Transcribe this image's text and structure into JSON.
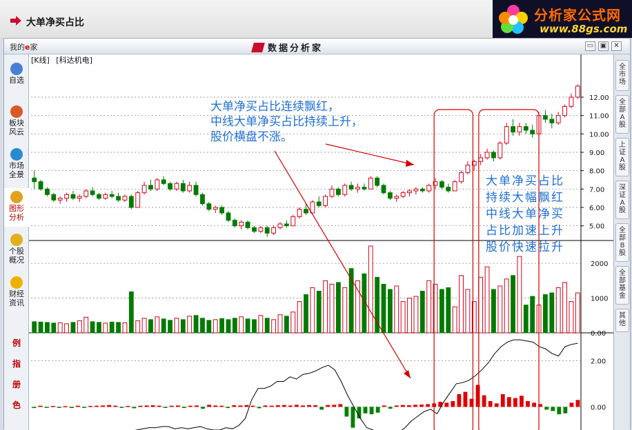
{
  "topbar": {
    "title": "大单净买占比"
  },
  "logo": {
    "line1": "分析家公式网",
    "line2": "www.88gs.com"
  },
  "window": {
    "home_label": "我的",
    "home_suffix": "家",
    "title": "数据分析家",
    "btn_min": "▭",
    "btn_max": "▣",
    "btn_close": "✕"
  },
  "left_sidebar": [
    {
      "label": "自选",
      "icon": "magnifier-icon",
      "color": "#4a7fd6"
    },
    {
      "label": "板块\n风云",
      "icon": "blocks-icon",
      "color": "#d85a28"
    },
    {
      "label": "市场\n全景",
      "icon": "globe-icon",
      "color": "#2a8ad0"
    },
    {
      "label": "图形\n分析",
      "icon": "chart-icon",
      "color": "#e0a020"
    },
    {
      "label": "个股\n概况",
      "icon": "stock-icon",
      "color": "#e0b020"
    },
    {
      "label": "财经\n资讯",
      "icon": "finance-icon",
      "color": "#f0b000"
    }
  ],
  "left_tools": [
    "例",
    "指",
    "册",
    "色"
  ],
  "right_tabs": [
    "全市场",
    "全部A股",
    "上证A股",
    "深证A股",
    "全部B股",
    "全部基金",
    "其他"
  ],
  "chart_header": {
    "period": "[K线]",
    "stock": "[科达机电]"
  },
  "annotations": {
    "left": [
      "大单净买占比连续飘红，",
      "中线大单净买占比持续上升，",
      "股价横盘不涨。"
    ],
    "right": [
      "大单净买占比",
      "持续大幅飘红",
      "中线大单净买",
      "占比加速上升",
      "股价快速拉升"
    ]
  },
  "chart_data": [
    {
      "type": "candlestick",
      "ylim": [
        4.2,
        13.2
      ],
      "y_ticks": [
        "12.00",
        "11.00",
        "10.00",
        "9.00",
        "8.00",
        "7.00",
        "6.00",
        "5.00"
      ],
      "up_color": "#d0021b",
      "down_color": "#007a00",
      "candles": [
        [
          7.6,
          8.0,
          7.0,
          7.4
        ],
        [
          7.4,
          7.5,
          6.9,
          7.0
        ],
        [
          7.0,
          7.1,
          6.6,
          6.7
        ],
        [
          6.7,
          6.8,
          6.3,
          6.4
        ],
        [
          6.4,
          6.6,
          6.2,
          6.5
        ],
        [
          6.5,
          6.8,
          6.3,
          6.7
        ],
        [
          6.7,
          6.9,
          6.4,
          6.5
        ],
        [
          6.5,
          6.7,
          6.3,
          6.6
        ],
        [
          6.6,
          7.0,
          6.5,
          6.9
        ],
        [
          6.9,
          7.1,
          6.6,
          6.7
        ],
        [
          6.7,
          6.8,
          6.4,
          6.5
        ],
        [
          6.5,
          6.8,
          6.4,
          6.7
        ],
        [
          6.7,
          6.9,
          6.5,
          6.6
        ],
        [
          6.6,
          6.8,
          6.3,
          6.4
        ],
        [
          6.4,
          6.7,
          6.3,
          6.6
        ],
        [
          6.6,
          6.7,
          5.9,
          6.0
        ],
        [
          6.0,
          6.9,
          6.0,
          6.8
        ],
        [
          6.8,
          7.4,
          6.7,
          7.2
        ],
        [
          7.2,
          7.5,
          6.9,
          7.0
        ],
        [
          7.0,
          7.6,
          6.9,
          7.5
        ],
        [
          7.5,
          7.7,
          7.2,
          7.3
        ],
        [
          7.3,
          7.4,
          6.9,
          7.0
        ],
        [
          7.0,
          7.4,
          6.9,
          7.3
        ],
        [
          7.3,
          7.5,
          6.8,
          6.9
        ],
        [
          6.9,
          7.4,
          6.8,
          7.2
        ],
        [
          7.2,
          7.4,
          6.6,
          6.7
        ],
        [
          6.7,
          6.8,
          6.1,
          6.2
        ],
        [
          6.2,
          6.3,
          5.8,
          5.9
        ],
        [
          5.9,
          6.1,
          5.7,
          6.0
        ],
        [
          6.0,
          6.1,
          5.6,
          5.7
        ],
        [
          5.7,
          5.8,
          5.2,
          5.3
        ],
        [
          5.3,
          5.4,
          4.9,
          5.0
        ],
        [
          5.0,
          5.3,
          4.8,
          5.2
        ],
        [
          5.2,
          5.3,
          4.8,
          4.9
        ],
        [
          4.9,
          5.0,
          4.6,
          4.7
        ],
        [
          4.7,
          5.0,
          4.6,
          4.9
        ],
        [
          4.9,
          5.0,
          4.4,
          4.6
        ],
        [
          4.6,
          5.0,
          4.5,
          4.9
        ],
        [
          4.9,
          5.2,
          4.8,
          5.1
        ],
        [
          5.1,
          5.3,
          4.9,
          5.0
        ],
        [
          5.0,
          5.6,
          5.0,
          5.5
        ],
        [
          5.5,
          6.0,
          5.4,
          5.9
        ],
        [
          5.9,
          6.2,
          5.6,
          5.7
        ],
        [
          5.7,
          6.4,
          5.7,
          6.3
        ],
        [
          6.3,
          6.6,
          6.0,
          6.1
        ],
        [
          6.1,
          6.7,
          6.0,
          6.6
        ],
        [
          6.6,
          7.2,
          6.5,
          7.0
        ],
        [
          7.0,
          7.1,
          6.6,
          6.7
        ],
        [
          6.7,
          7.3,
          6.6,
          7.2
        ],
        [
          7.2,
          7.4,
          6.9,
          7.0
        ],
        [
          7.0,
          7.3,
          6.8,
          7.1
        ],
        [
          7.1,
          7.3,
          6.9,
          7.0
        ],
        [
          7.0,
          7.7,
          7.0,
          7.6
        ],
        [
          7.6,
          7.7,
          7.1,
          7.2
        ],
        [
          7.2,
          7.3,
          6.7,
          6.8
        ],
        [
          6.8,
          6.9,
          6.4,
          6.5
        ],
        [
          6.5,
          6.7,
          6.3,
          6.6
        ],
        [
          6.6,
          6.9,
          6.5,
          6.8
        ],
        [
          6.8,
          7.0,
          6.6,
          6.9
        ],
        [
          6.9,
          7.1,
          6.7,
          7.0
        ],
        [
          7.0,
          7.1,
          6.8,
          6.9
        ],
        [
          6.9,
          7.3,
          6.8,
          7.2
        ],
        [
          7.2,
          7.6,
          7.0,
          7.4
        ],
        [
          7.4,
          7.5,
          7.0,
          7.1
        ],
        [
          7.1,
          7.3,
          6.8,
          6.9
        ],
        [
          6.9,
          7.5,
          6.9,
          7.4
        ],
        [
          7.4,
          8.0,
          7.3,
          7.9
        ],
        [
          7.9,
          8.5,
          7.8,
          8.3
        ],
        [
          8.3,
          8.6,
          8.0,
          8.5
        ],
        [
          8.5,
          8.9,
          8.3,
          8.7
        ],
        [
          8.7,
          9.2,
          8.6,
          9.0
        ],
        [
          9.0,
          9.1,
          8.5,
          8.7
        ],
        [
          8.7,
          9.6,
          8.6,
          9.5
        ],
        [
          9.5,
          10.6,
          9.4,
          10.4
        ],
        [
          10.4,
          10.8,
          9.9,
          10.1
        ],
        [
          10.1,
          10.6,
          9.9,
          10.4
        ],
        [
          10.4,
          10.6,
          10.0,
          10.2
        ],
        [
          10.2,
          10.5,
          9.8,
          10.0
        ],
        [
          10.0,
          11.2,
          9.9,
          11.0
        ],
        [
          11.0,
          11.3,
          10.6,
          10.8
        ],
        [
          10.8,
          11.1,
          10.3,
          10.6
        ],
        [
          10.6,
          11.2,
          10.5,
          11.0
        ],
        [
          11.0,
          11.6,
          10.9,
          11.5
        ],
        [
          11.5,
          12.2,
          11.4,
          12.0
        ],
        [
          12.0,
          12.7,
          11.9,
          12.6
        ]
      ],
      "volume_ylim": [
        0,
        2500
      ],
      "volume_ticks": [
        "2000",
        "1000",
        "0.00"
      ],
      "volumes": [
        320,
        310,
        300,
        280,
        290,
        260,
        300,
        350,
        450,
        320,
        300,
        280,
        310,
        300,
        290,
        1180,
        350,
        420,
        380,
        460,
        400,
        360,
        420,
        380,
        480,
        500,
        420,
        360,
        380,
        410,
        380,
        420,
        460,
        400,
        380,
        500,
        420,
        380,
        520,
        480,
        600,
        900,
        1100,
        1300,
        1200,
        1500,
        1400,
        1450,
        1300,
        1850,
        1500,
        1700,
        2500,
        1600,
        1400,
        1250,
        1350,
        900,
        1000,
        1050,
        1200,
        1500,
        1400,
        1250,
        1300,
        750,
        1650,
        1250,
        900,
        1600,
        1900,
        1250,
        1350,
        1550,
        1650,
        2200,
        800,
        1050,
        800,
        1100,
        1150,
        1300,
        1450,
        900,
        1150
      ],
      "indicator_ylim": [
        -1.0,
        3.2
      ],
      "indicator_ticks": [
        "2.00",
        "0.00"
      ],
      "bars": [
        -0.05,
        0.05,
        -0.03,
        0.04,
        -0.04,
        0.03,
        -0.05,
        0.05,
        -0.03,
        0.04,
        0.05,
        0.06,
        0.08,
        0.05,
        -0.04,
        0.04,
        -0.06,
        0.05,
        0.06,
        0.07,
        0.05,
        -0.04,
        0.05,
        0.06,
        -0.05,
        0.05,
        0.06,
        -0.08,
        0.09,
        0.06,
        0.05,
        -0.05,
        0.07,
        0.06,
        0.08,
        0.05,
        -0.06,
        0.06,
        0.05,
        0.07,
        0.08,
        0.06,
        0.09,
        0.06,
        0.08,
        0.07,
        -0.12,
        0.08,
        0.09,
        0.12,
        -0.42,
        -0.9,
        -0.5,
        -0.28,
        -0.32,
        -0.25,
        0.06,
        -0.08,
        0.06,
        0.08,
        0.07,
        0.09,
        0.1,
        0.12,
        0.15,
        0.22,
        0.18,
        0.25,
        0.55,
        0.65,
        0.35,
        0.95,
        0.5,
        0.25,
        0.15,
        0.55,
        0.42,
        0.38,
        0.48,
        0.25,
        0.18,
        0.12,
        -0.12,
        -0.18,
        -0.32,
        -0.28,
        0.18,
        0.3
      ],
      "line": [
        -1.5,
        -1.4,
        -1.3,
        -1.25,
        -1.3,
        -1.25,
        -1.2,
        -1.15,
        -1.1,
        -1.15,
        -1.1,
        -1.1,
        -1.05,
        -1.05,
        -1.1,
        -1.05,
        -1.0,
        -0.95,
        -0.9,
        -0.9,
        -0.85,
        -0.85,
        -0.95,
        -0.9,
        -0.95,
        -0.9,
        -0.85,
        -0.95,
        -1.0,
        -1.0,
        -0.9,
        -0.95,
        -0.8,
        -0.5,
        0.3,
        0.8,
        0.8,
        0.9,
        1.1,
        1.1,
        1.3,
        1.2,
        1.4,
        1.45,
        1.55,
        1.7,
        1.8,
        1.6,
        1.1,
        0.5,
        0.0,
        -0.5,
        -0.9,
        -1.0,
        -1.1,
        -1.15,
        -1.2,
        -1.1,
        -0.9,
        -0.6,
        -0.4,
        -0.2,
        -0.1,
        -0.3,
        0.2,
        0.6,
        1.0,
        1.05,
        1.15,
        1.35,
        1.6,
        1.9,
        2.3,
        2.6,
        2.8,
        2.9,
        2.9,
        2.85,
        2.8,
        2.6,
        2.5,
        2.3,
        2.2,
        2.6,
        2.7,
        2.75
      ]
    }
  ]
}
